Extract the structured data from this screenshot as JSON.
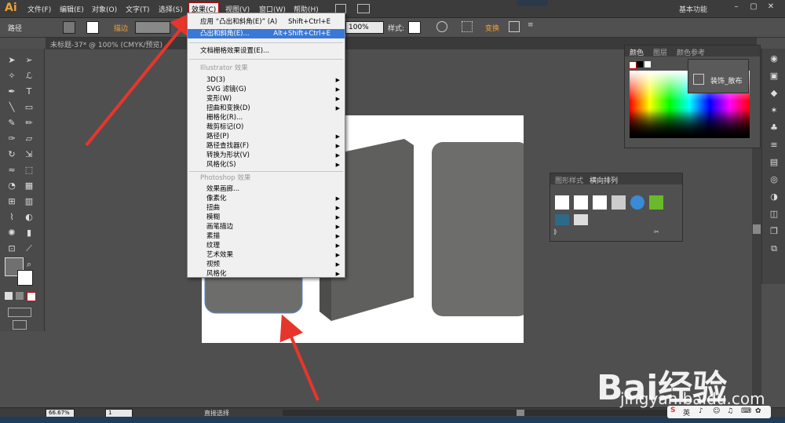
{
  "app": {
    "logo": "Ai"
  },
  "menubar": {
    "items": [
      "文件(F)",
      "编辑(E)",
      "对象(O)",
      "文字(T)",
      "选择(S)",
      "效果(C)",
      "视图(V)",
      "窗口(W)",
      "帮助(H)"
    ],
    "active": "效果(C)",
    "workspace": "基本功能"
  },
  "controlbar": {
    "label": "路径",
    "stroke_label": "描边",
    "opacity_value": "100%",
    "style_label": "样式:",
    "transform_label": "变换"
  },
  "document": {
    "tab_title": "未标题-37* @ 100% (CMYK/预览)"
  },
  "dropdown": {
    "items": [
      {
        "label": "应用 “凸出和斜角(E)” (A)",
        "shortcut": "Shift+Ctrl+E",
        "highlight": false
      },
      {
        "label": "凸出和斜角(E)...",
        "shortcut": "Alt+Shift+Ctrl+E",
        "highlight": true
      },
      {
        "label": "文档栅格效果设置(E)..."
      }
    ],
    "illustrator_header": "Illustrator 效果",
    "illustrator_items": [
      {
        "label": "3D(3)",
        "sub": true
      },
      {
        "label": "SVG 滤镜(G)",
        "sub": true
      },
      {
        "label": "变形(W)",
        "sub": true
      },
      {
        "label": "扭曲和变换(D)",
        "sub": true
      },
      {
        "label": "栅格化(R)...",
        "sub": false
      },
      {
        "label": "裁剪标记(O)",
        "sub": false
      },
      {
        "label": "路径(P)",
        "sub": true
      },
      {
        "label": "路径查找器(F)",
        "sub": true
      },
      {
        "label": "转换为形状(V)",
        "sub": true
      },
      {
        "label": "风格化(S)",
        "sub": true
      }
    ],
    "photoshop_header": "Photoshop 效果",
    "photoshop_items": [
      {
        "label": "效果画廊...",
        "sub": false
      },
      {
        "label": "像素化",
        "sub": true
      },
      {
        "label": "扭曲",
        "sub": true
      },
      {
        "label": "模糊",
        "sub": true
      },
      {
        "label": "画笔描边",
        "sub": true
      },
      {
        "label": "素描",
        "sub": true
      },
      {
        "label": "纹理",
        "sub": true
      },
      {
        "label": "艺术效果",
        "sub": true
      },
      {
        "label": "视频",
        "sub": true
      },
      {
        "label": "风格化",
        "sub": true
      }
    ]
  },
  "color_panel": {
    "tabs": [
      "颜色",
      "图层",
      "颜色参考"
    ]
  },
  "popup_panel": {
    "label": "装饰_散布"
  },
  "styles_panel": {
    "tabs": [
      "图形样式",
      "横向排列"
    ]
  },
  "status": {
    "zoom": "66.67%",
    "page": "1",
    "tool": "直接选择"
  },
  "watermark": {
    "brand": "Bai经验",
    "url": "jingyan.baidu.com"
  },
  "ime": {
    "label": "英"
  },
  "colors": {
    "accent_highlight": "#3a78d6",
    "menu_bg": "#3c3c3c",
    "shape_gray": "#6d6e6b",
    "arrow_red": "#e8352b"
  }
}
